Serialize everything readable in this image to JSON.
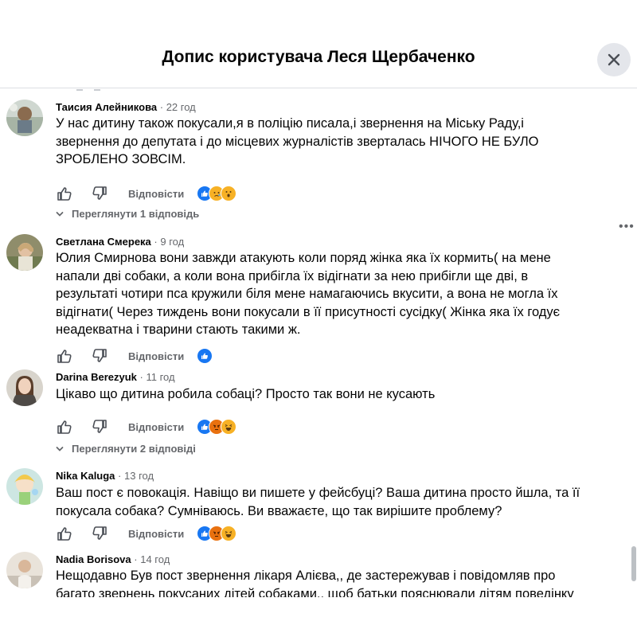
{
  "header": {
    "title": "Допис користувача Леся Щербаченко"
  },
  "action_labels": {
    "reply": "Відповісти"
  },
  "comments": [
    {
      "author": "Таисия Алейникова",
      "time": "22 год",
      "lines": [
        "У нас дитину також покусали,я в поліцію писала,і звернення на Міську Раду,і",
        "звернення до депутата і до місцевих журналістів зверталась НІЧОГО НЕ БУЛО",
        "ЗРОБЛЕНО ЗОВСІМ."
      ],
      "reactions": [
        "like",
        "sad",
        "wow"
      ]
    },
    {
      "author": "Светлана Смерека",
      "time": "9 год",
      "lines": [
        "Юлия Смирнова вони завжди атакують коли поряд жінка яка їх кормить( на мене",
        "напали дві собаки, а коли вона прибігла їх відігнати за нею прибігли ще дві, в",
        "результаті чотири пса кружили біля мене намагаючись вкусити, а вона не могла їх",
        "відігнати( Через тиждень вони покусали в її присутності сусідку( Жінка яка їх годує",
        "неадекватна і тварини стають такими ж."
      ],
      "reactions": [
        "like"
      ]
    },
    {
      "author": "Darina Berezyuk",
      "time": "11 год",
      "lines": [
        "Цікаво що дитина робила собаці? Просто так вони не кусають"
      ],
      "reactions": [
        "like",
        "angry",
        "haha"
      ]
    },
    {
      "author": "Nika Kaluga",
      "time": "13 год",
      "lines": [
        "Ваш пост є повокація. Навіщо ви пишете у фейсбуці? Ваша дитина просто йшла, та її",
        "покусала собака? Сумніваюсь. Ви вважаєте, що так вирішите проблему?"
      ],
      "reactions": [
        "like",
        "angry",
        "haha"
      ]
    },
    {
      "author": "Nadia Borisova",
      "time": "14 год",
      "lines": [
        "Нещодавно Був пост звернення лікаря Алієва,, де застережував і повідомляв про",
        "багато звернень покусаних дітей собаками,, щоб батьки пояснювали дітям поведінку"
      ]
    }
  ],
  "view_replies": [
    "Переглянути 1 відповідь",
    "Переглянути 2 відповіді"
  ],
  "icons": {
    "close": "close-icon",
    "like": "like-icon",
    "dislike": "dislike-icon",
    "more": "more-options-icon",
    "chevron": "chevron-down-icon"
  },
  "colors": {
    "like_blue": "#1877f2",
    "reaction_yellow": "#f7b125",
    "angry_red": "#e9710f",
    "secondary_text": "#65676b"
  }
}
